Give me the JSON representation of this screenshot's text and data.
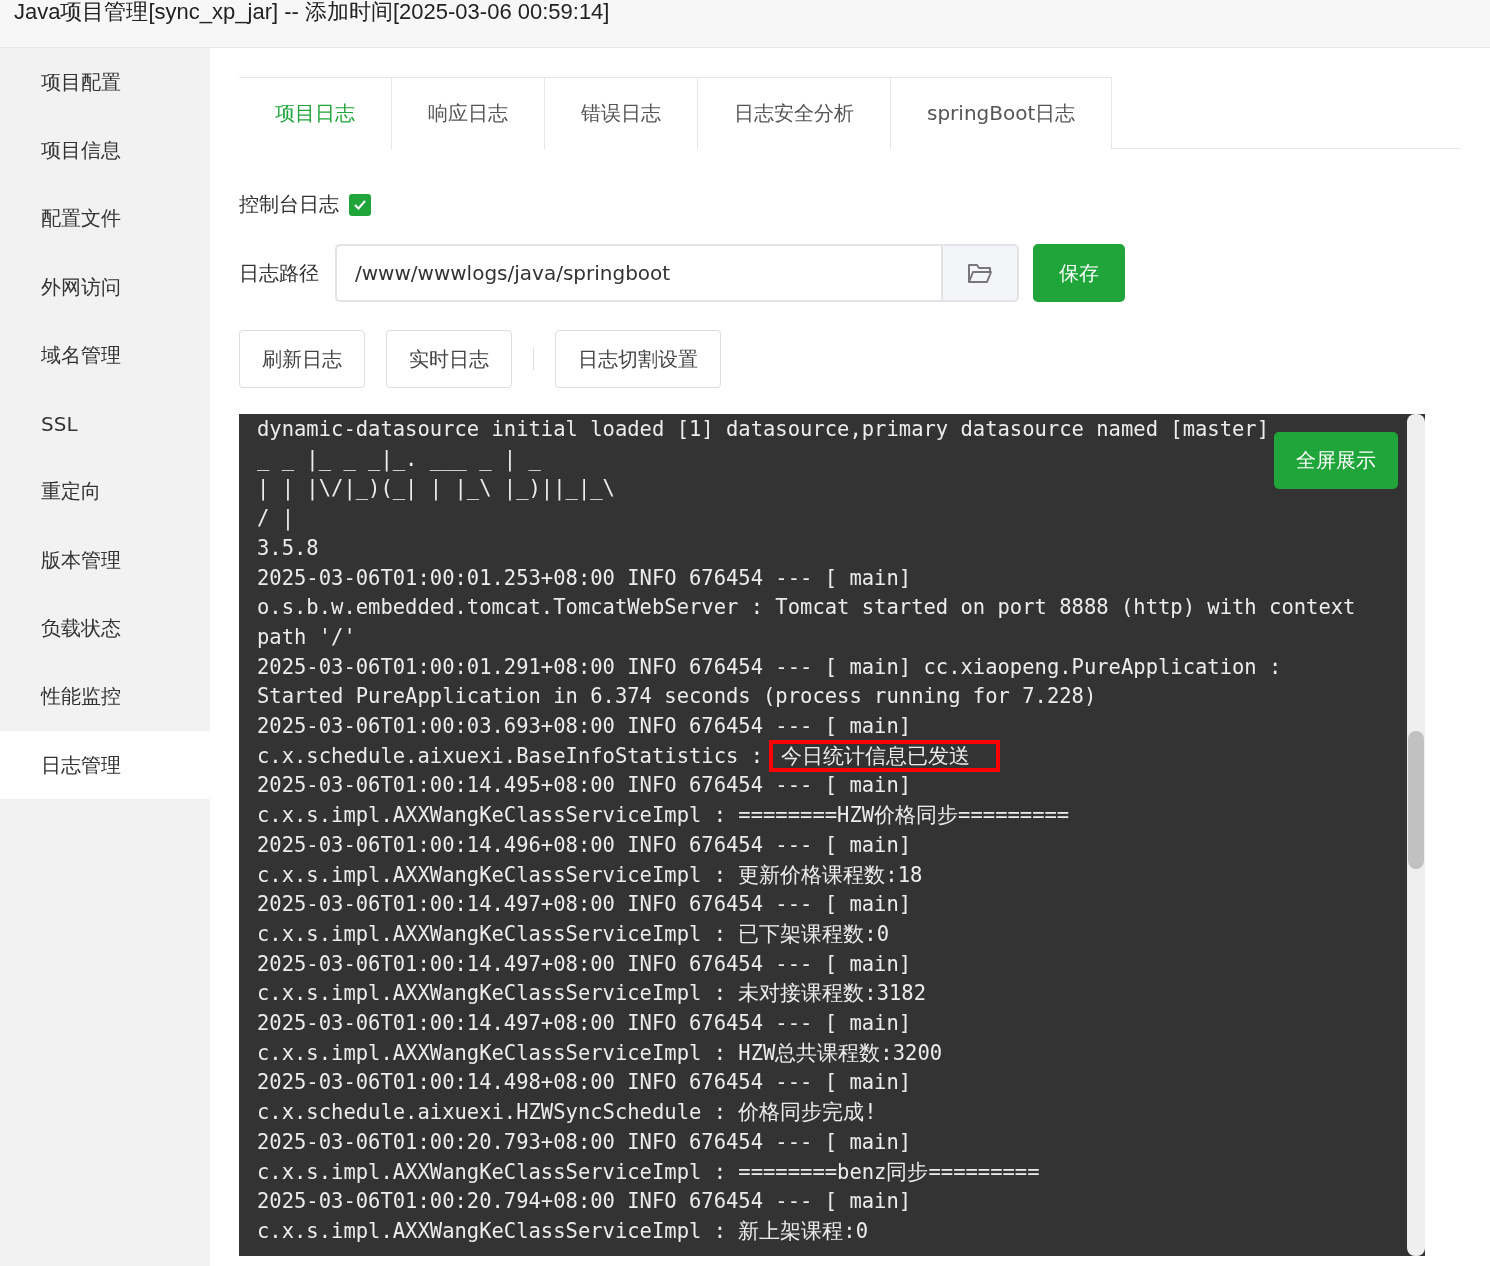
{
  "window": {
    "title": "Java项目管理[sync_xp_jar] -- 添加时间[2025-03-06 00:59:14]"
  },
  "sidebar": {
    "items": [
      {
        "label": "项目配置",
        "selected": false
      },
      {
        "label": "项目信息",
        "selected": false
      },
      {
        "label": "配置文件",
        "selected": false
      },
      {
        "label": "外网访问",
        "selected": false
      },
      {
        "label": "域名管理",
        "selected": false
      },
      {
        "label": "SSL",
        "selected": false
      },
      {
        "label": "重定向",
        "selected": false
      },
      {
        "label": "版本管理",
        "selected": false
      },
      {
        "label": "负载状态",
        "selected": false
      },
      {
        "label": "性能监控",
        "selected": false
      },
      {
        "label": "日志管理",
        "selected": true
      }
    ]
  },
  "tabs": [
    {
      "label": "项目日志",
      "selected": true
    },
    {
      "label": "响应日志",
      "selected": false
    },
    {
      "label": "错误日志",
      "selected": false
    },
    {
      "label": "日志安全分析",
      "selected": false
    },
    {
      "label": "springBoot日志",
      "selected": false
    }
  ],
  "console_log": {
    "label": "控制台日志",
    "checked": true
  },
  "log_path": {
    "label": "日志路径",
    "value": "/www/wwwlogs/java/springboot",
    "save_button": "保存"
  },
  "actions": [
    "刷新日志",
    "实时日志",
    "日志切割设置"
  ],
  "log": {
    "fullscreen_button": "全屏展示",
    "lines": [
      {
        "text": "dynamic-datasource initial loaded [1] datasource,primary datasource named [master]"
      },
      {
        "text": "_ _ |_ _ _|_. ___ _ | _"
      },
      {
        "text": "| | |\\/|_)(_| | |_\\ |_)||_|_\\"
      },
      {
        "text": "/ |"
      },
      {
        "text": "3.5.8"
      },
      {
        "text": "2025-03-06T01:00:01.253+08:00 INFO 676454 --- [ main]"
      },
      {
        "text": "o.s.b.w.embedded.tomcat.TomcatWebServer : Tomcat started on port 8888 (http) with context"
      },
      {
        "text": "path '/'"
      },
      {
        "text": "2025-03-06T01:00:01.291+08:00 INFO 676454 --- [ main] cc.xiaopeng.PureApplication :"
      },
      {
        "text": "Started PureApplication in 6.374 seconds (process running for 7.228)"
      },
      {
        "text": "2025-03-06T01:00:03.693+08:00 INFO 676454 --- [ main]"
      },
      {
        "text": "c.x.schedule.aixuexi.BaseInfoStatistics : ",
        "highlight": "今日统计信息已发送"
      },
      {
        "text": "2025-03-06T01:00:14.495+08:00 INFO 676454 --- [ main]"
      },
      {
        "text": "c.x.s.impl.AXXWangKeClassServiceImpl : ========HZW价格同步========="
      },
      {
        "text": "2025-03-06T01:00:14.496+08:00 INFO 676454 --- [ main]"
      },
      {
        "text": "c.x.s.impl.AXXWangKeClassServiceImpl : 更新价格课程数:18"
      },
      {
        "text": "2025-03-06T01:00:14.497+08:00 INFO 676454 --- [ main]"
      },
      {
        "text": "c.x.s.impl.AXXWangKeClassServiceImpl : 已下架课程数:0"
      },
      {
        "text": "2025-03-06T01:00:14.497+08:00 INFO 676454 --- [ main]"
      },
      {
        "text": "c.x.s.impl.AXXWangKeClassServiceImpl : 未对接课程数:3182"
      },
      {
        "text": "2025-03-06T01:00:14.497+08:00 INFO 676454 --- [ main]"
      },
      {
        "text": "c.x.s.impl.AXXWangKeClassServiceImpl : HZW总共课程数:3200"
      },
      {
        "text": "2025-03-06T01:00:14.498+08:00 INFO 676454 --- [ main]"
      },
      {
        "text": "c.x.schedule.aixuexi.HZWSyncSchedule : 价格同步完成!"
      },
      {
        "text": "2025-03-06T01:00:20.793+08:00 INFO 676454 --- [ main]"
      },
      {
        "text": "c.x.s.impl.AXXWangKeClassServiceImpl : ========benz同步========="
      },
      {
        "text": "2025-03-06T01:00:20.794+08:00 INFO 676454 --- [ main]"
      },
      {
        "text": "c.x.s.impl.AXXWangKeClassServiceImpl : 新上架课程:0"
      }
    ]
  }
}
